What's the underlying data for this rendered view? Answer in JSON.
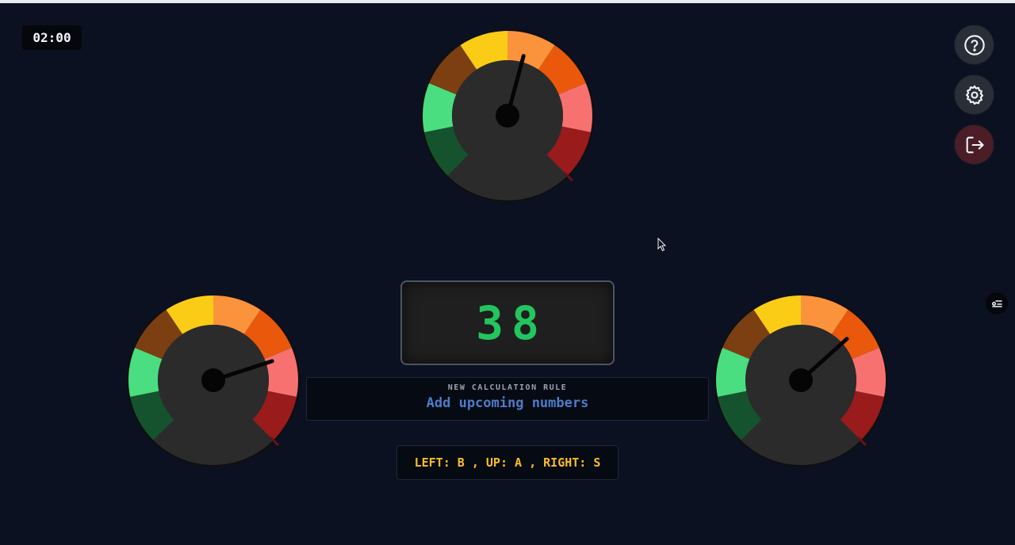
{
  "timer": "02:00",
  "display": {
    "value": "38"
  },
  "rule": {
    "label": "NEW CALCULATION RULE",
    "text": "Add upcoming numbers"
  },
  "keys": "LEFT: B , UP: A , RIGHT: S",
  "gauges": [
    {
      "id": "up",
      "needle_angle_deg": 15
    },
    {
      "id": "left",
      "needle_angle_deg": 72
    },
    {
      "id": "right",
      "needle_angle_deg": 48
    }
  ],
  "gauge_zone_colors": [
    "#14532d",
    "#4ade80",
    "#7c3f12",
    "#facc15",
    "#fb923c",
    "#ea580c",
    "#f87171",
    "#991b1b"
  ],
  "icons": {
    "help": "question-circle-icon",
    "settings": "gear-icon",
    "exit": "logout-icon",
    "extra": "settings-panel-icon"
  }
}
